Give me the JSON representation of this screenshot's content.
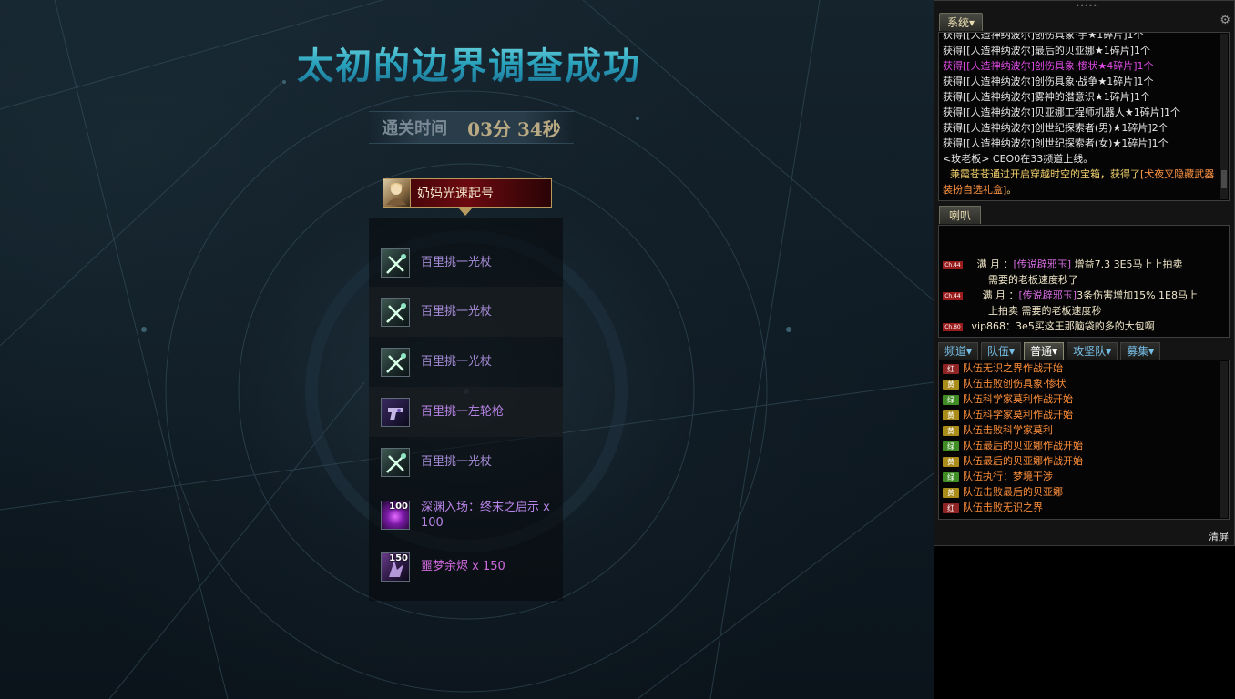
{
  "scene": {
    "title": "太初的边界调查成功",
    "clear_time_label": "通关时间",
    "clear_time_value": "03分 34秒",
    "player_name": "奶妈光速起号",
    "loot": [
      {
        "name": "百里挑一光杖",
        "icon": "staff-icon",
        "qty": ""
      },
      {
        "name": "百里挑一光杖",
        "icon": "staff-icon",
        "qty": ""
      },
      {
        "name": "百里挑一光杖",
        "icon": "staff-icon",
        "qty": ""
      },
      {
        "name": "百里挑一左轮枪",
        "icon": "revolver-icon",
        "qty": ""
      },
      {
        "name": "百里挑一光杖",
        "icon": "staff-icon",
        "qty": ""
      },
      {
        "name": "深渊入场：终末之启示 x 100",
        "icon": "abyss-orb-icon",
        "qty": "100"
      },
      {
        "name": "噩梦余烬 x 150",
        "icon": "nightmare-ember-icon",
        "qty": "150"
      }
    ]
  },
  "chat": {
    "system_tab": "系统▾",
    "system_log": [
      "获得[[人造神纳波尔]创伤具象·手★1碎片]1个",
      "获得[[人造神纳波尔]最后的贝亚娜★1碎片]1个",
      "获得[[人造神纳波尔]创伤具象·惨状★4碎片]1个",
      "获得[[人造神纳波尔]创伤具象·战争★1碎片]1个",
      "获得[[人造神纳波尔]雾神的潜意识★1碎片]1个",
      "获得[[人造神纳波尔]贝亚娜工程师机器人★1碎片]1个",
      "获得[[人造神纳波尔]创世纪探索者(男)★1碎片]2个",
      "获得[[人造神纳波尔]创世纪探索者(女)★1碎片]1个",
      "<玫老板> CEO0在33频道上线。"
    ],
    "system_last_pre": "兼霞苍苍通过开启穿越时空的宝箱，获得了",
    "system_last_item": "[犬夜叉隐藏武器装扮自选礼盒]",
    "system_last_post": "。",
    "horn_tab": "喇叭",
    "horn_messages": [
      {
        "badge": "Ch.44",
        "name": "满 月",
        "item": "[传说辟邪玉]",
        "text": "增益7.3  3E5马上上拍卖",
        "line2": "需要的老板速度秒了"
      },
      {
        "badge": "Ch.44",
        "name": "满 月",
        "item": "[传说辟邪玉]",
        "text": "3条伤害增加15%  1E8马上",
        "line2": "上拍卖 需要的老板速度秒"
      },
      {
        "badge": "Ch.80",
        "name": "vip868",
        "item": "",
        "text": "3e5买这王那脑袋的多的大包啊",
        "line2": ""
      }
    ],
    "channel_tabs": [
      "频道▾",
      "队伍▾",
      "普通▾",
      "攻坚队▾",
      "募集▾"
    ],
    "active_channel": "普通▾",
    "channel_log": [
      {
        "tag": "红",
        "color": "red",
        "text": "队伍无识之界作战开始"
      },
      {
        "tag": "黄",
        "color": "yellow",
        "text": "队伍击败创伤具象·惨状"
      },
      {
        "tag": "绿",
        "color": "green",
        "text": "队伍科学家莫利作战开始"
      },
      {
        "tag": "黄",
        "color": "yellow",
        "text": "队伍科学家莫利作战开始"
      },
      {
        "tag": "黄",
        "color": "yellow",
        "text": "队伍击败科学家莫利"
      },
      {
        "tag": "绿",
        "color": "green",
        "text": "队伍最后的贝亚娜作战开始"
      },
      {
        "tag": "黄",
        "color": "yellow",
        "text": "队伍最后的贝亚娜作战开始"
      },
      {
        "tag": "绿",
        "color": "green",
        "text": "队伍执行：梦境干涉"
      },
      {
        "tag": "黄",
        "color": "yellow",
        "text": "队伍击败最后的贝亚娜"
      },
      {
        "tag": "红",
        "color": "red",
        "text": "队伍击败无识之界"
      }
    ],
    "clear_label": "清屏"
  }
}
